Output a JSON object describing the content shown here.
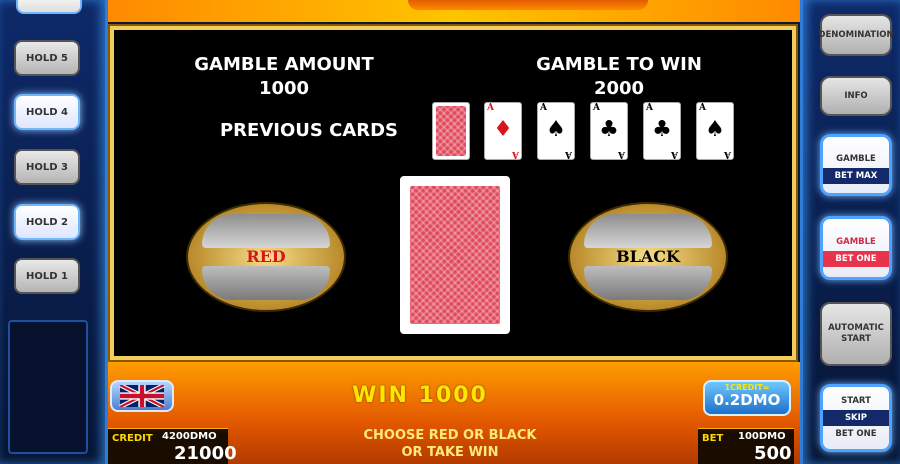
{
  "hold_buttons": [
    "HOLD 5",
    "HOLD 4",
    "HOLD 3",
    "HOLD 2",
    "HOLD 1"
  ],
  "right_buttons": {
    "denomination": "DENOMINATION",
    "info": "INFO",
    "gamble_max_top": "GAMBLE",
    "gamble_max_bottom": "BET MAX",
    "gamble_one_top": "GAMBLE",
    "gamble_one_bottom": "BET ONE",
    "auto_top": "AUTOMATIC",
    "auto_bottom": "START",
    "start": "START",
    "skip": "SKIP",
    "bet_one": "BET ONE"
  },
  "gamble": {
    "amount_label": "GAMBLE AMOUNT",
    "amount_value": "1000",
    "towin_label": "GAMBLE TO WIN",
    "towin_value": "2000",
    "previous_label": "PREVIOUS CARDS",
    "previous_cards": [
      {
        "rank": "A",
        "suit": "♦",
        "color": "red"
      },
      {
        "rank": "A",
        "suit": "♠",
        "color": "black"
      },
      {
        "rank": "A",
        "suit": "♣",
        "color": "black"
      },
      {
        "rank": "A",
        "suit": "♣",
        "color": "black"
      },
      {
        "rank": "A",
        "suit": "♠",
        "color": "black"
      }
    ],
    "red_label": "RED",
    "black_label": "BLACK"
  },
  "bottom": {
    "win_text": "WIN 1000",
    "message_line1": "CHOOSE RED OR BLACK",
    "message_line2": "OR TAKE WIN",
    "credit_label": "CREDIT",
    "credit_dmo": "4200DMO",
    "credit_value": "21000",
    "bet_label": "BET",
    "bet_dmo": "100DMO",
    "bet_value": "500",
    "credit_denom_label": "1CREDIT=",
    "credit_denom_value": "0.2DMO"
  },
  "colors": {
    "red_word": "#d8141c",
    "black_word": "#000000",
    "win_text": "#ffe600",
    "board_border": "#f2cd5c"
  }
}
